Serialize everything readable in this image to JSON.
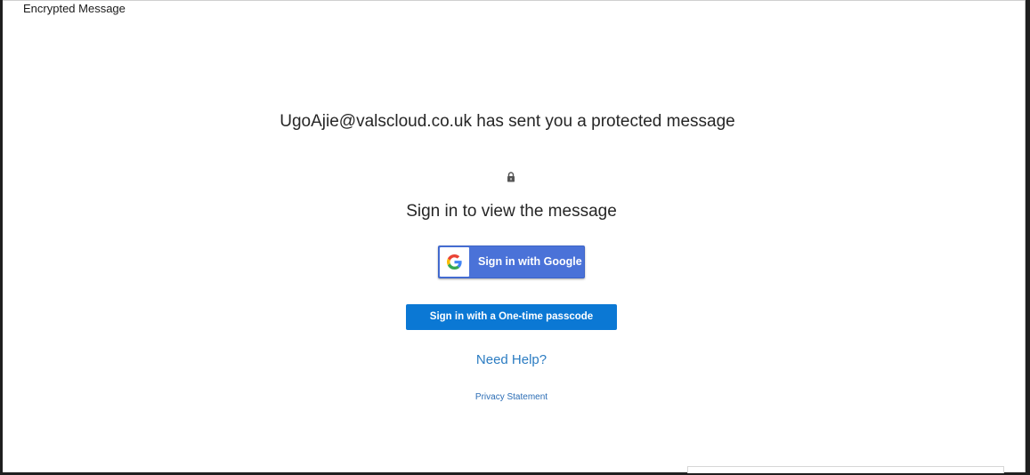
{
  "window": {
    "title": "Encrypted Message"
  },
  "message": {
    "sender_line": "UgoAjie@valscloud.co.uk has sent you a protected message",
    "lock_icon": "lock-icon",
    "signin_heading": "Sign in to view the message"
  },
  "actions": {
    "google_label": "Sign in with Google",
    "google_icon": "google-g-icon",
    "otp_label": "Sign in with a One-time passcode",
    "help_label": "Need Help?",
    "privacy_label": "Privacy Statement"
  },
  "colors": {
    "google_button": "#4a72d8",
    "otp_button": "#0b78d4",
    "link": "#2b7cc2"
  }
}
